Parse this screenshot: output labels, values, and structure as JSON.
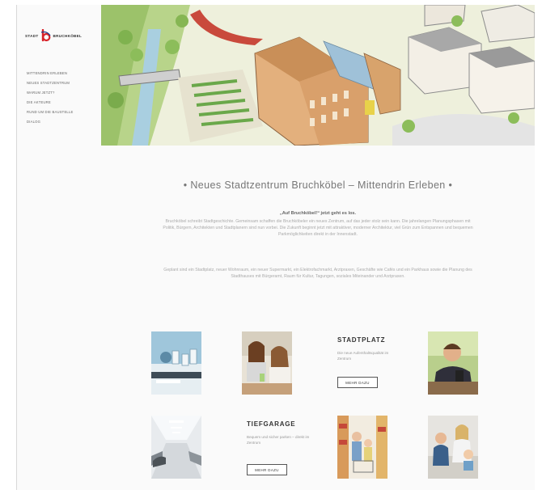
{
  "logo": {
    "left_text": "STADT",
    "right_text": "BRUCHKÖBEL"
  },
  "nav": [
    "Mittendrin erleben",
    "Neues Stadtzentrum",
    "Warum jetzt?",
    "Die Akteure",
    "Rund um die Baustelle",
    "Dialog"
  ],
  "intro": {
    "headline": "•  Neues Stadtzentrum Bruchköbel – Mittendrin Erleben  •",
    "lead": "„Auf Bruchköbel!“ jetzt geht es los.",
    "paragraph1": "Bruchköbel schreibt Stadtgeschichte. Gemeinsam schaffen die Bruchköbeler ein neues Zentrum, auf das jeder stolz sein kann. Die jahrelangen Planungsphasen mit Politik, Bürgern, Architekten und Stadtplanern sind nun vorbei. Die Zukunft beginnt jetzt mit attraktiver, moderner Architektur, viel Grün zum Entspannen und bequemen Parkmöglichkeiten direkt in der Innenstadt.",
    "paragraph2": "Geplant sind ein Stadtplatz, neuer Wohnraum, ein neuer Supermarkt, ein Elektrofachmarkt, Arztpraxen, Geschäfte wie Cafés und ein Parkhaus sowie die Planung des Stadthauses mit Bürgeramt, Raum für Kultur, Tagungen, soziales Miteinander und Arztpraxen."
  },
  "cards": {
    "stadtplatz": {
      "title": "STADTPLATZ",
      "text": "Die neue Aufenthaltsqualität im Zentrum",
      "button": "MEHR DAZU"
    },
    "tiefgarage": {
      "title": "TIEFGARAGE",
      "text": "Bequem und sicher parken – direkt im Zentrum",
      "button": "MEHR DAZU"
    }
  }
}
